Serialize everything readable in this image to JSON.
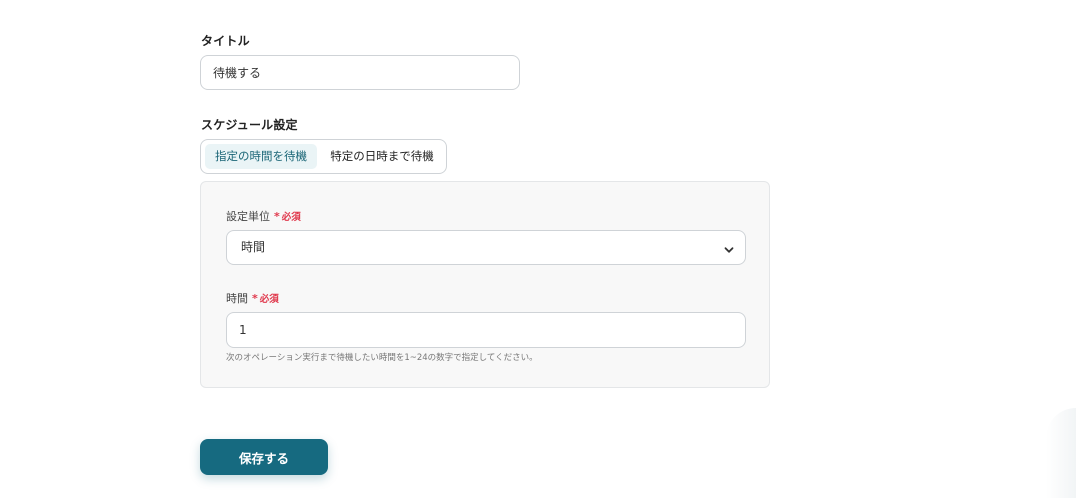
{
  "title_section": {
    "label": "タイトル",
    "value": "待機する"
  },
  "schedule_section": {
    "label": "スケジュール設定",
    "tabs": [
      {
        "label": "指定の時間を待機",
        "active": true
      },
      {
        "label": "特定の日時まで待機",
        "active": false
      }
    ]
  },
  "unit_field": {
    "label": "設定単位",
    "required_star": "*",
    "required_text": "必須",
    "selected": "時間"
  },
  "hours_field": {
    "label": "時間",
    "required_star": "*",
    "required_text": "必須",
    "value": "1",
    "help": "次のオペレーション実行まで待機したい時間を1~24の数字で指定してください。"
  },
  "save_button": {
    "label": "保存する"
  },
  "colors": {
    "accent": "#166a80",
    "active_tab_bg": "#eaf4f6",
    "required": "#e0394d"
  },
  "icons": {
    "select_arrow": "chevron-down-icon"
  }
}
